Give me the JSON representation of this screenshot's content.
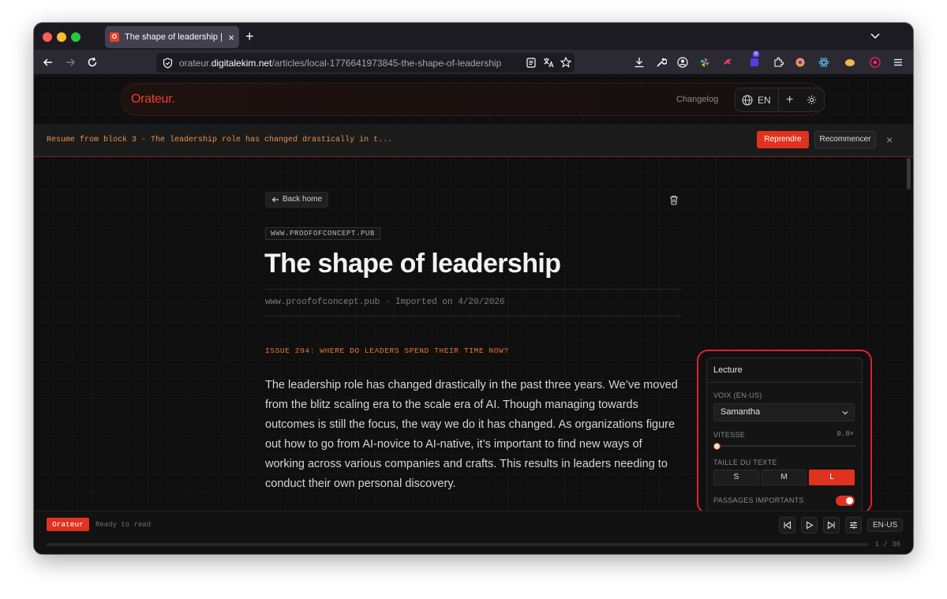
{
  "browser": {
    "tab_title": "The shape of leadership | Orateur",
    "tab_favicon": "O",
    "url_prefix": "orateur.",
    "url_domain": "digitalekim.net",
    "url_path": "/articles/local-1776641973845-the-shape-of-leadership",
    "extension_badge": "6"
  },
  "header": {
    "logo": "Orateur.",
    "changelog": "Changelog",
    "lang": "EN",
    "plus": "+"
  },
  "resume": {
    "text": "Resume from block 3 - The leadership role has changed drastically in t...",
    "resume_label": "Reprendre",
    "restart_label": "Recommencer",
    "close": "×"
  },
  "article": {
    "back_label": "Back home",
    "source_badge": "WWW.PROOFOFCONCEPT.PUB",
    "title": "The shape of leadership",
    "meta": "www.proofofconcept.pub · Imported on 4/20/2026",
    "issue": "ISSUE 294: WHERE DO LEADERS SPEND THEIR TIME NOW?",
    "paragraph": "The leadership role has changed drastically in the past three years. We’ve moved from the blitz scaling era to the scale era of AI. Though managing towards outcomes is still the focus, the way we do it has changed. As organizations figure out how to go from AI-novice to AI-native, it’s important to find new ways of working across various companies and crafts. This results in leaders needing to conduct their own personal discovery."
  },
  "reading_panel": {
    "title": "Lecture",
    "voice_label": "VOIX (EN-US)",
    "voice_value": "Samantha",
    "speed_label": "VITESSE",
    "speed_value": "0.8×",
    "speed_fraction": 0.0,
    "text_size_label": "TAILLE DU TEXTE",
    "sizes": [
      "S",
      "M",
      "L"
    ],
    "selected_size": "L",
    "highlights_label": "PASSAGES IMPORTANTS",
    "highlights_on": true
  },
  "player": {
    "brand": "Orateur",
    "status": "Ready to read",
    "locale": "EN-US",
    "counter": "1 / 36",
    "progress": 0.0
  },
  "colors": {
    "accent": "#e0321f",
    "highlight_border": "#e0212e",
    "issue_orange": "#e8773f"
  },
  "icons": [
    "back-icon",
    "forward-icon",
    "reload-icon",
    "shield-icon",
    "reader-icon",
    "translate-icon",
    "star-icon",
    "download-icon",
    "wrench-icon",
    "account-icon",
    "globe-icon",
    "gear-icon",
    "trash-icon",
    "arrow-left-icon",
    "chevron-down-icon",
    "skip-back-icon",
    "play-icon",
    "skip-forward-icon",
    "sliders-icon",
    "menu-icon"
  ]
}
